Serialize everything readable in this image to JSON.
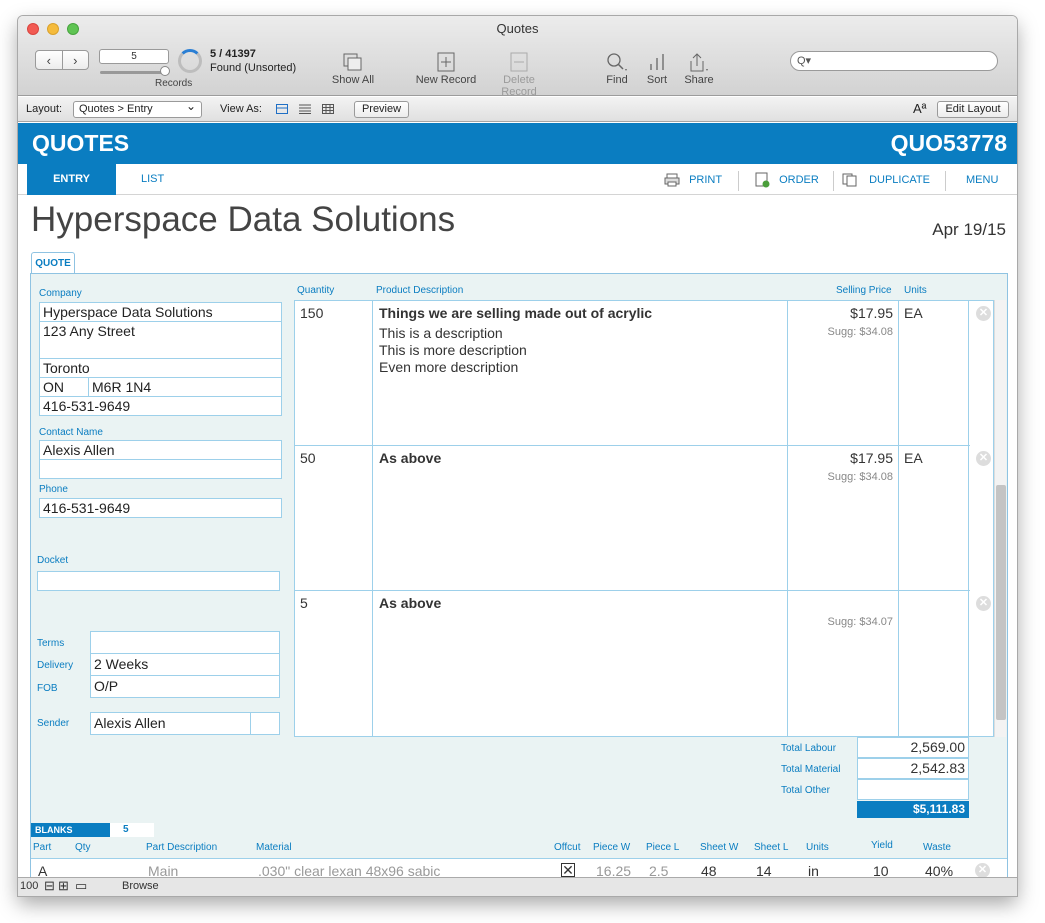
{
  "window": {
    "title": "Quotes"
  },
  "toolbar": {
    "record_number": "5",
    "records_label": "Records",
    "found_count": "5 / 41397",
    "found_status": "Found (Unsorted)",
    "show_all": "Show All",
    "new_record": "New Record",
    "delete_record": "Delete Record",
    "find": "Find",
    "sort": "Sort",
    "share": "Share",
    "search_icon": "Q▾"
  },
  "layoutbar": {
    "layout_label": "Layout:",
    "layout_value": "Quotes > Entry",
    "view_as_label": "View As:",
    "preview": "Preview",
    "font_size_icon": "Aª",
    "edit_layout": "Edit Layout"
  },
  "header": {
    "title": "QUOTES",
    "quote_no": "QUO53778"
  },
  "tabs": {
    "entry": "ENTRY",
    "list": "LIST",
    "print": "PRINT",
    "order": "ORDER",
    "duplicate": "DUPLICATE",
    "menu": "MENU"
  },
  "company_name": "Hyperspace Data Solutions",
  "date": "Apr 19/15",
  "quote_tab": "QUOTE",
  "left": {
    "company_label": "Company",
    "company": "Hyperspace Data Solutions",
    "street": "123 Any Street",
    "street2": "",
    "city": "Toronto",
    "province": "ON",
    "postal": "M6R 1N4",
    "company_phone": "416-531-9649",
    "contact_label": "Contact Name",
    "contact": "Alexis Allen",
    "contact2": "",
    "phone_label": "Phone",
    "phone": "416-531-9649",
    "docket_label": "Docket",
    "docket": "",
    "terms_label": "Terms",
    "terms": "",
    "delivery_label": "Delivery",
    "delivery": "2 Weeks",
    "fob_label": "FOB",
    "fob": "O/P",
    "sender_label": "Sender",
    "sender": "Alexis Allen"
  },
  "grid": {
    "headers": {
      "qty": "Quantity",
      "desc": "Product Description",
      "price": "Selling Price",
      "units": "Units"
    },
    "rows": [
      {
        "qty": "150",
        "title": "Things we are selling made out of acrylic",
        "lines": [
          "This is a description",
          "This is more description",
          "Even more description"
        ],
        "price": "$17.95",
        "sugg": "Sugg: $34.08",
        "units": "EA"
      },
      {
        "qty": "50",
        "title": "As above",
        "lines": [],
        "price": "$17.95",
        "sugg": "Sugg: $34.08",
        "units": "EA"
      },
      {
        "qty": "5",
        "title": "As above",
        "lines": [],
        "price": "",
        "sugg": "Sugg: $34.07",
        "units": ""
      }
    ]
  },
  "totals": {
    "labour_label": "Total Labour",
    "labour": "2,569.00",
    "material_label": "Total Material",
    "material": "2,542.83",
    "other_label": "Total Other",
    "other": "",
    "grand": "$5,111.83"
  },
  "blanks": {
    "label": "BLANKS",
    "count": "5",
    "headers": [
      "Part",
      "Qty",
      "Part Description",
      "Material",
      "Offcut",
      "Piece W",
      "Piece L",
      "Sheet W",
      "Sheet L",
      "Units",
      "Yield",
      "Waste"
    ],
    "row": {
      "part": "A",
      "qty": "",
      "desc": "Main",
      "material": ".030\" clear lexan 48x96 sabic",
      "piece_w": "16.25",
      "piece_l": "2.5",
      "sheet_w": "48",
      "sheet_l": "14",
      "units": "in",
      "yield": "10",
      "waste": "40%"
    }
  },
  "status": {
    "zoom": "100",
    "mode": "Browse"
  }
}
